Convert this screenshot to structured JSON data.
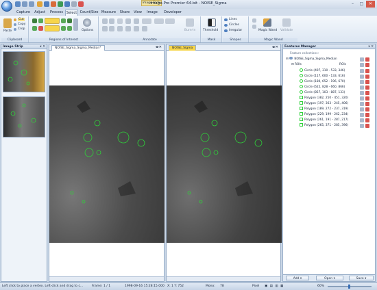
{
  "window": {
    "title": "Image-Pro Premier 64-bit - NOISE_Sigma",
    "context_tab": "Image Tools",
    "min": "–",
    "max": "□",
    "close": "✕"
  },
  "tabs": [
    "Capture",
    "Adjust",
    "Process",
    "Select",
    "Count/Size",
    "Measure",
    "Share",
    "View",
    "Image",
    "Developer"
  ],
  "active_tab": "Select",
  "ribbon": {
    "clipboard": {
      "paste": "Paste",
      "cut": "Cut",
      "copy": "Copy",
      "crop": "Crop",
      "label": "Clipboard"
    },
    "roi": {
      "label": "Regions of Interest",
      "options": "Options"
    },
    "annotate": {
      "label": "Annotate",
      "burn_in": "Burn-In"
    },
    "mask": {
      "label": "Mask",
      "threshold": "Threshold"
    },
    "shapes": {
      "label": "Shapes",
      "lines": "Lines",
      "circles": "Circles",
      "irregular": "Irregular"
    },
    "magic_wand": {
      "label": "Magic Wand",
      "magic_wand": "Magic Wand",
      "validate": "Validate"
    }
  },
  "image_strip": {
    "title": "Image Strip",
    "pin": "▾ ✕"
  },
  "documents": [
    {
      "tab": "NOISE_Sigma_Sigma_Median*"
    },
    {
      "tab": "NOISE_Sigma"
    }
  ],
  "features_manager": {
    "title": "Features Manager",
    "collections_label": "Feature collections:",
    "root": "NOISE_Sigma_Sigma_Median",
    "rois_left": "ROIs",
    "rois_right": "ROIs",
    "items": [
      "Circle (497, 310 - 533, 346)",
      "Circle (117, 600 - 133, 616)",
      "Circle (180, 652 - 196, 670)",
      "Circle (622, 828 - 660, 866)",
      "Circle (857, 103 - 887, 133)",
      "Polygon (382, 250 - 451, 320)",
      "Polygon (197, 363 - 245, 406)",
      "Polygon (189, 272 - 237, 319)",
      "Polygon (229, 199 - 262, 234)",
      "Polygon (261, 191 - 287, 217)",
      "Polygon (265, 371 - 285, 396)"
    ],
    "buttons": {
      "add": "Add",
      "open": "Open",
      "save": "Save"
    }
  },
  "status": {
    "hint": "Left click to place a vertex. Left-click and drag to c...",
    "frame": "Frame: 1 / 1",
    "date": "1998-09-16 15:28:15.000",
    "coords": "X: 1   Y: 752",
    "mono_label": "Mono:",
    "mono_value": "78",
    "pixel": "Pixel",
    "zoom": "60%"
  },
  "colors": {
    "accent": "#3a6fb5",
    "roi_green": "#2fd13a",
    "active_tab_yellow": "#f7d54a"
  }
}
